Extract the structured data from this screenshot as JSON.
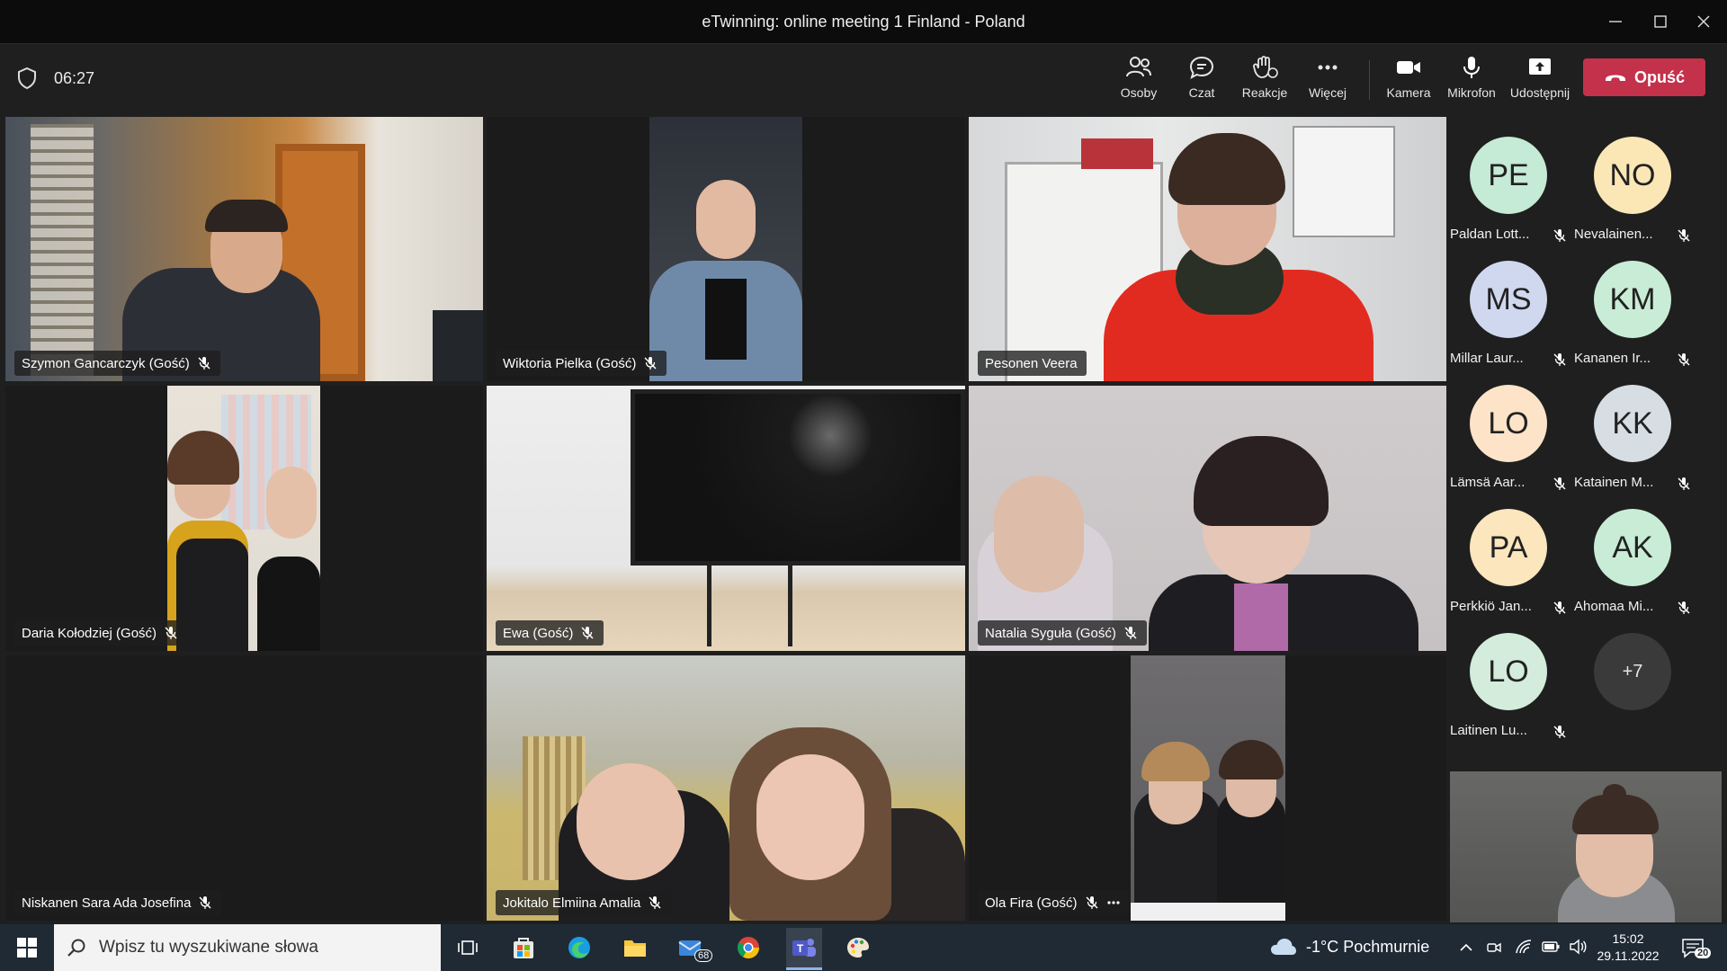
{
  "window": {
    "title": "eTwinning: online meeting 1 Finland - Poland"
  },
  "toolbar": {
    "timer": "06:27",
    "people_label": "Osoby",
    "chat_label": "Czat",
    "reactions_label": "Reakcje",
    "more_label": "Więcej",
    "camera_label": "Kamera",
    "mic_label": "Mikrofon",
    "share_label": "Udostępnij",
    "leave_label": "Opuść"
  },
  "tiles": [
    {
      "name": "Szymon Gancarczyk (Gość)"
    },
    {
      "name": "Wiktoria Pielka (Gość)"
    },
    {
      "name": "Pesonen Veera"
    },
    {
      "name": "Daria Kołodziej (Gość)"
    },
    {
      "name": "Ewa (Gość)"
    },
    {
      "name": "Natalia Syguła (Gość)"
    },
    {
      "name": "Niskanen Sara Ada Josefina"
    },
    {
      "name": "Jokitalo Elmiina Amalia"
    },
    {
      "name": "Ola Fira (Gość)"
    }
  ],
  "roster": [
    {
      "initials": "PE",
      "name": "Paldan Lott...",
      "color": "#c5ead5"
    },
    {
      "initials": "NO",
      "name": "Nevalainen...",
      "color": "#fbe7b6"
    },
    {
      "initials": "MS",
      "name": "Millar Laur...",
      "color": "#cfd8ee"
    },
    {
      "initials": "KM",
      "name": "Kananen Ir...",
      "color": "#c9ecd6"
    },
    {
      "initials": "LO",
      "name": "Lämsä Aar...",
      "color": "#fde3c8"
    },
    {
      "initials": "KK",
      "name": "Katainen M...",
      "color": "#d6dde3"
    },
    {
      "initials": "PA",
      "name": "Perkkiö Jan...",
      "color": "#fbe6bd"
    },
    {
      "initials": "AK",
      "name": "Ahomaa Mi...",
      "color": "#c9ecd6"
    },
    {
      "initials": "LO",
      "name": "Laitinen Lu...",
      "color": "#d3ecdc"
    }
  ],
  "roster_more": "+7",
  "taskbar": {
    "search_placeholder": "Wpisz tu wyszukiwane słowa",
    "mail_badge": "68",
    "weather": "-1°C  Pochmurnie",
    "time": "15:02",
    "date": "29.11.2022",
    "notifications": "20"
  },
  "colors": {
    "leave": "#c4314b",
    "taskbar": "#202a35",
    "background": "#1f1f1f"
  }
}
